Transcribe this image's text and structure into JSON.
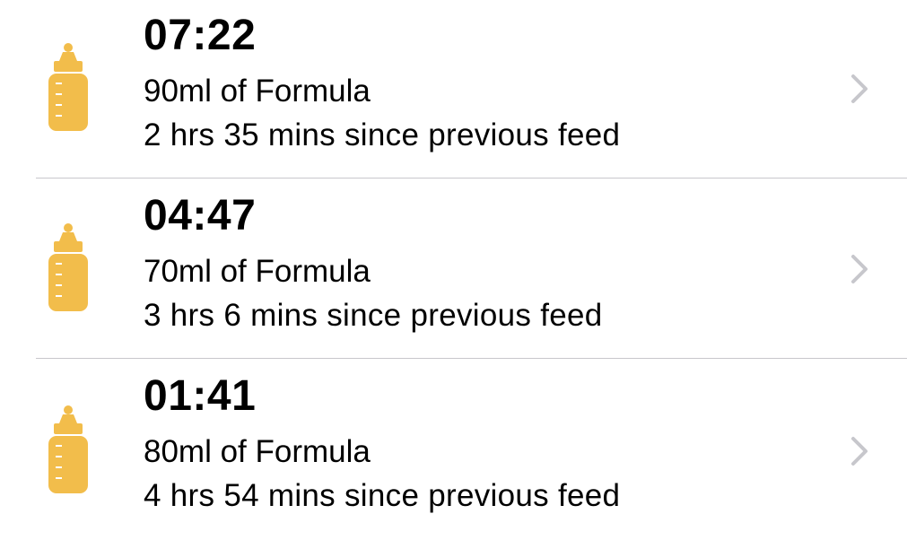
{
  "feeds": [
    {
      "time": "07:22",
      "amount": "90ml of Formula",
      "interval": "2 hrs 35 mins since previous feed",
      "icon": "baby-bottle-icon"
    },
    {
      "time": "04:47",
      "amount": "70ml of Formula",
      "interval": "3 hrs 6 mins since previous feed",
      "icon": "baby-bottle-icon"
    },
    {
      "time": "01:41",
      "amount": "80ml of Formula",
      "interval": "4 hrs 54 mins since previous feed",
      "icon": "baby-bottle-icon"
    }
  ],
  "colors": {
    "bottle": "#f2bd4b",
    "bottle_markings": "#ffffff",
    "chevron": "#c7c7cc",
    "separator": "#c8c7cc",
    "text": "#000000"
  }
}
